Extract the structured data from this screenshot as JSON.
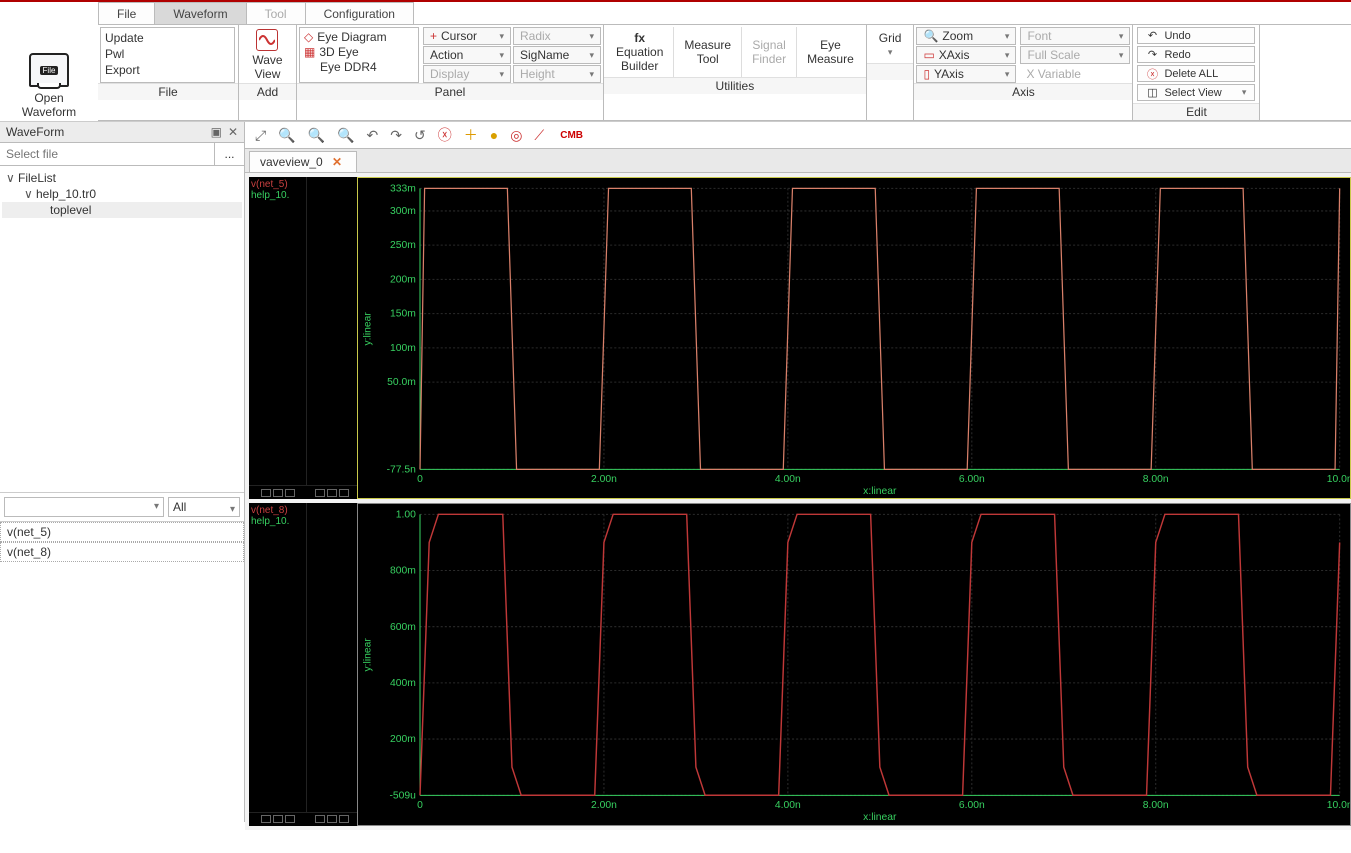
{
  "menu": {
    "tabs": [
      "File",
      "Waveform",
      "Tool",
      "Configuration"
    ],
    "active": 1
  },
  "openWaveform": {
    "label1": "Open",
    "label2": "Waveform",
    "iconText": "File"
  },
  "ribbon": {
    "file": {
      "title": "File",
      "items": [
        "Update",
        "Pwl",
        "Export"
      ]
    },
    "add": {
      "title": "Add",
      "btn1": "Wave",
      "btn2": "View"
    },
    "panel": {
      "title": "Panel",
      "eye": [
        "Eye Diagram",
        "3D Eye",
        "Eye DDR4"
      ],
      "row1": [
        "Cursor",
        "Radix"
      ],
      "row2": [
        "Action",
        "SigName"
      ],
      "row3": [
        "Display",
        "Height"
      ]
    },
    "utilities": {
      "title": "Utilities",
      "eqb1": "fx",
      "eqb2": "Equation",
      "eqb3": "Builder",
      "meas1": "Measure",
      "meas2": "Tool",
      "sig1": "Signal",
      "sig2": "Finder",
      "eye1": "Eye",
      "eye2": "Measure"
    },
    "grid": {
      "label": "Grid"
    },
    "axis": {
      "title": "Axis",
      "zoom": "Zoom",
      "xaxis": "XAxis",
      "yaxis": "YAxis",
      "font": "Font",
      "fullscale": "Full Scale",
      "xvar": "X Variable"
    },
    "edit": {
      "title": "Edit",
      "undo": "Undo",
      "redo": "Redo",
      "delall": "Delete ALL",
      "selview": "Select View"
    }
  },
  "sidebar": {
    "title": "WaveForm",
    "selectPlaceholder": "Select file",
    "browse": "...",
    "tree": {
      "root": "FileList",
      "file": "help_10.tr0",
      "node": "toplevel"
    },
    "filterAll": "All",
    "nets": [
      "v(net_5)",
      "v(net_8)"
    ]
  },
  "viewer": {
    "tab": "vaveview_0",
    "cmb": "CMB",
    "plot1": {
      "sig": "v(net_5)",
      "file": "help_10."
    },
    "plot2": {
      "sig": "v(net_8)",
      "file": "help_10."
    }
  },
  "chart_data": [
    {
      "type": "line",
      "title": "v(net_5)",
      "xlabel": "x:linear",
      "ylabel": "y:linear",
      "xlim": [
        0,
        10
      ],
      "ylim": [
        -77.5,
        333
      ],
      "xticks": [
        0,
        2,
        4,
        6,
        8,
        10
      ],
      "xticklabels": [
        "0",
        "2.00n",
        "4.00n",
        "6.00n",
        "8.00n",
        "10.0n"
      ],
      "yticks": [
        -77.5,
        50,
        100,
        150,
        200,
        250,
        300,
        333
      ],
      "yticklabels": [
        "-77.5n",
        "50.0m",
        "100m",
        "150m",
        "200m",
        "250m",
        "300m",
        "333m"
      ],
      "x": [
        0,
        0.05,
        0.95,
        1.05,
        1.95,
        2.05,
        2.95,
        3.05,
        3.95,
        4.05,
        4.95,
        5.05,
        5.95,
        6.05,
        6.95,
        7.05,
        7.95,
        8.05,
        8.95,
        9.05,
        9.95,
        10
      ],
      "y": [
        -77.5,
        333,
        333,
        -77.5,
        -77.5,
        333,
        333,
        -77.5,
        -77.5,
        333,
        333,
        -77.5,
        -77.5,
        333,
        333,
        -77.5,
        -77.5,
        333,
        333,
        -77.5,
        -77.5,
        333
      ]
    },
    {
      "type": "line",
      "title": "v(net_8)",
      "xlabel": "x:linear",
      "ylabel": "y:linear",
      "xlim": [
        0,
        10
      ],
      "ylim": [
        -0.000509,
        1.0
      ],
      "xticks": [
        0,
        2,
        4,
        6,
        8,
        10
      ],
      "xticklabels": [
        "0",
        "2.00n",
        "4.00n",
        "6.00n",
        "8.00n",
        "10.0n"
      ],
      "yticks": [
        -0.000509,
        0.2,
        0.4,
        0.6,
        0.8,
        1.0
      ],
      "yticklabels": [
        "-509u",
        "200m",
        "400m",
        "600m",
        "800m",
        "1.00"
      ],
      "x": [
        0,
        0.1,
        0.2,
        0.9,
        1.0,
        1.1,
        1.9,
        2.0,
        2.1,
        2.2,
        2.9,
        3.0,
        3.1,
        3.9,
        4.0,
        4.1,
        4.2,
        4.9,
        5.0,
        5.1,
        5.9,
        6.0,
        6.1,
        6.2,
        6.9,
        7.0,
        7.1,
        7.9,
        8.0,
        8.1,
        8.2,
        8.9,
        9.0,
        9.1,
        9.9,
        10
      ],
      "y": [
        0,
        0.9,
        1.0,
        1.0,
        0.1,
        0,
        0,
        0.9,
        1.0,
        1.0,
        1.0,
        0.1,
        0,
        0,
        0.9,
        1.0,
        1.0,
        1.0,
        0.1,
        0,
        0,
        0.9,
        1.0,
        1.0,
        1.0,
        0.1,
        0,
        0,
        0.9,
        1.0,
        1.0,
        1.0,
        0.1,
        0,
        0,
        0.9
      ]
    }
  ]
}
